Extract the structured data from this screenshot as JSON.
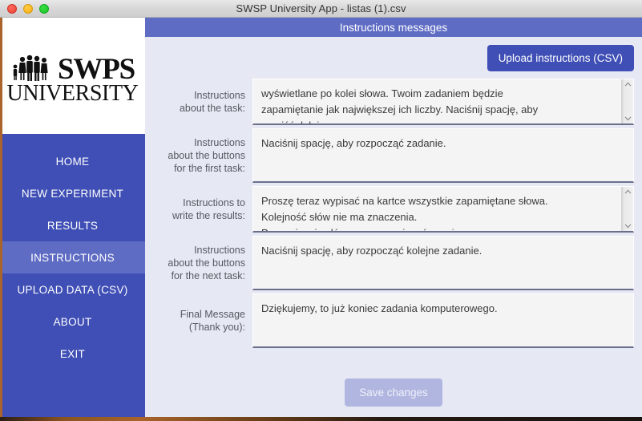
{
  "window": {
    "title": "SWSP University App - listas (1).csv",
    "controls": [
      "close-button",
      "minimize-button",
      "maximize-button"
    ]
  },
  "sidebar": {
    "logo": {
      "line1": "SWPS",
      "line2": "UNIVERSITY",
      "icon": "people-group-icon"
    },
    "items": [
      {
        "label": "HOME",
        "active": false
      },
      {
        "label": "NEW EXPERIMENT",
        "active": false
      },
      {
        "label": "RESULTS",
        "active": false
      },
      {
        "label": "INSTRUCTIONS",
        "active": true
      },
      {
        "label": "UPLOAD DATA (CSV)",
        "active": false
      },
      {
        "label": "ABOUT",
        "active": false
      },
      {
        "label": "EXIT",
        "active": false
      }
    ]
  },
  "content": {
    "header_title": "Instructions messages",
    "upload_button_label": "Upload instructions (CSV)",
    "save_button_label": "Save changes",
    "fields": [
      {
        "label_line1": "Instructions",
        "label_line2": "about the task:",
        "label_line3": "",
        "value": "wyświetlane po kolei słowa. Twoim zadaniem będzie\nzapamiętanie jak największej ich liczby. Naciśnij spację, aby\nprzejść dalej.",
        "scrollbar": true
      },
      {
        "label_line1": "Instructions",
        "label_line2": "about the buttons",
        "label_line3": "for the first task:",
        "value": "Naciśnij spację, aby rozpocząć zadanie.",
        "scrollbar": false
      },
      {
        "label_line1": "Instructions to",
        "label_line2": "write the results:",
        "label_line3": "",
        "value": "Proszę teraz wypisać na kartce wszystkie zapamiętane słowa.\nKolejność słów nie ma znaczenia.\nPo wypisaniu słów, proszę nacisnąć spację.",
        "scrollbar": true
      },
      {
        "label_line1": "Instructions",
        "label_line2": "about the buttons",
        "label_line3": "for the next task:",
        "value": "Naciśnij spację, aby rozpocząć kolejne zadanie.",
        "scrollbar": false
      },
      {
        "label_line1": "Final Message",
        "label_line2": "(Thank you):",
        "label_line3": "",
        "value": "Dziękujemy, to już koniec zadania komputerowego.",
        "scrollbar": false
      }
    ]
  },
  "colors": {
    "sidebar_blue": "#3f4fb5",
    "header_blue": "#5f6cc4",
    "content_bg": "#e6e8f4",
    "field_bg": "#f4f4f4",
    "save_disabled": "#b0b6e0"
  }
}
